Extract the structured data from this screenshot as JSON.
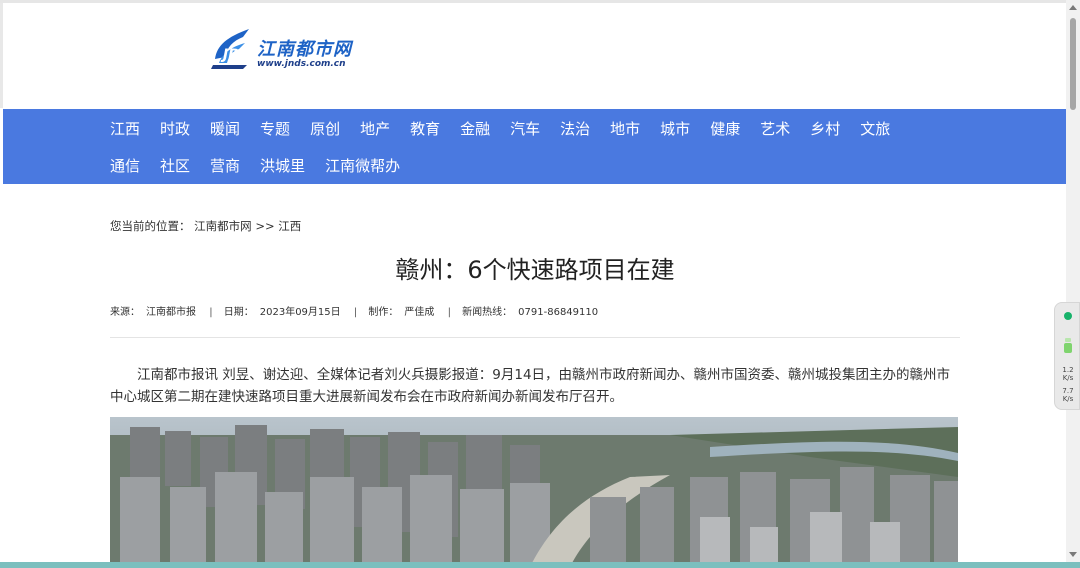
{
  "logo": {
    "name": "江南都市网",
    "url": "www.jnds.com.cn"
  },
  "nav": {
    "row1": [
      "江西",
      "时政",
      "暖闻",
      "专题",
      "原创",
      "地产",
      "教育",
      "金融",
      "汽车",
      "法治",
      "地市",
      "城市",
      "健康",
      "艺术",
      "乡村",
      "文旅"
    ],
    "row2": [
      "通信",
      "社区",
      "营商",
      "洪城里",
      "江南微帮办"
    ]
  },
  "breadcrumb": {
    "prefix": "您当前的位置：",
    "home": "江南都市网",
    "separator": ">>",
    "section": "江西"
  },
  "article": {
    "title": "赣州：6个快速路项目在建",
    "meta": {
      "source_label": "来源：",
      "source": "江南都市报",
      "date_label": "日期：",
      "date": "2023年09月15日",
      "editor_label": "制作：",
      "editor": "严佳成",
      "hotline_label": "新闻热线：",
      "hotline": "0791-86849110"
    },
    "paragraph": "江南都市报讯 刘昱、谢达迎、全媒体记者刘火兵摄影报道：9月14日，由赣州市政府新闻办、赣州市国资委、赣州城投集团主办的赣州市中心城区第二期在建快速路项目重大进展新闻发布会在市政府新闻办新闻发布厅召开。"
  },
  "widget": {
    "speed_up": "1.2",
    "speed_up_unit": "K/s",
    "speed_down": "7.7",
    "speed_down_unit": "K/s"
  },
  "colors": {
    "nav_bg": "#4a79e0",
    "logo_blue": "#1e63c6",
    "status_green": "#17b26a"
  }
}
